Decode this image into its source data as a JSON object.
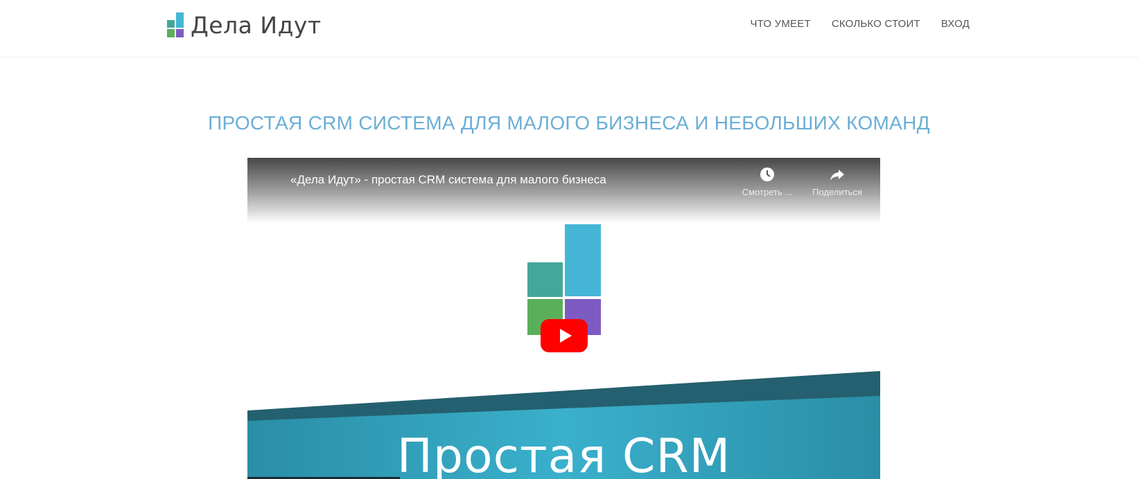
{
  "brand": {
    "name": "Дела Идут",
    "colors": {
      "teal": "#45a69b",
      "blue": "#45b5d6",
      "green": "#5aaf5a",
      "purple": "#7d5bc2"
    }
  },
  "nav": {
    "items": [
      {
        "label": "ЧТО УМЕЕТ"
      },
      {
        "label": "СКОЛЬКО СТОИТ"
      },
      {
        "label": "ВХОД"
      }
    ]
  },
  "hero": {
    "title": "ПРОСТАЯ CRM СИСТЕМА ДЛЯ МАЛОГО БИЗНЕСА И НЕБОЛЬШИХ КОМАНД",
    "title_color": "#6aaed6"
  },
  "video": {
    "title": "«Дела Идут» - простая CRM система для малого бизнеса",
    "watch_later_label": "Смотреть ...",
    "share_label": "Поделиться",
    "caption": "Простая CRM",
    "play_icon": "play-icon",
    "band_color": "#2f8fa6"
  }
}
